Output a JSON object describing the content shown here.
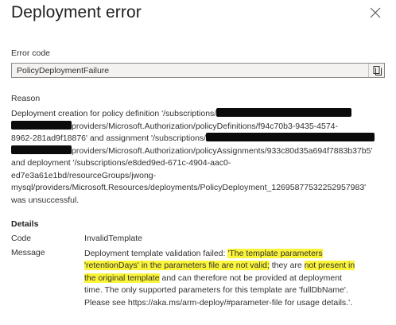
{
  "dialog": {
    "title": "Deployment error",
    "close_label": "Close"
  },
  "error_code": {
    "label": "Error code",
    "value": "PolicyDeploymentFailure"
  },
  "reason": {
    "label": "Reason",
    "lines": [
      [
        "Deployment creation for policy definition '/subscriptions/",
        "[redacted]"
      ],
      [
        "[redacted]",
        "providers/Microsoft.Authorization/policyDefinitions/f94c70b3-9435-4574-"
      ],
      [
        "8962-281ad9f18876' and assignment '/subscriptions/",
        "[redacted]"
      ],
      [
        "[redacted]",
        "providers/Microsoft.Authorization/policyAssignments/933c80d35a694f7883b37b5'"
      ],
      [
        "and deployment '/subscriptions/e8ded9ed-671c-4904-aac0-"
      ],
      [
        "ed7e3a61e1bd/resourceGroups/jwong-"
      ],
      [
        "mysql/providers/Microsoft.Resources/deployments/PolicyDeployment_12695877532252957983'"
      ],
      [
        "was unsuccessful."
      ]
    ]
  },
  "details": {
    "heading": "Details",
    "code_label": "Code",
    "code_value": "InvalidTemplate",
    "message_label": "Message",
    "message_parts": [
      "Deployment template validation failed: ",
      "'The template parameters",
      "'retentionDays' in the parameters file are not valid;",
      " they are ",
      "not present in",
      "the original template",
      " and can therefore not be provided at deployment",
      "time. The only supported parameters for this template are 'fullDbName'.",
      "Please see https://aka.ms/arm-deploy/#parameter-file for usage details.'."
    ],
    "highlight_color": "#fbf53a"
  }
}
